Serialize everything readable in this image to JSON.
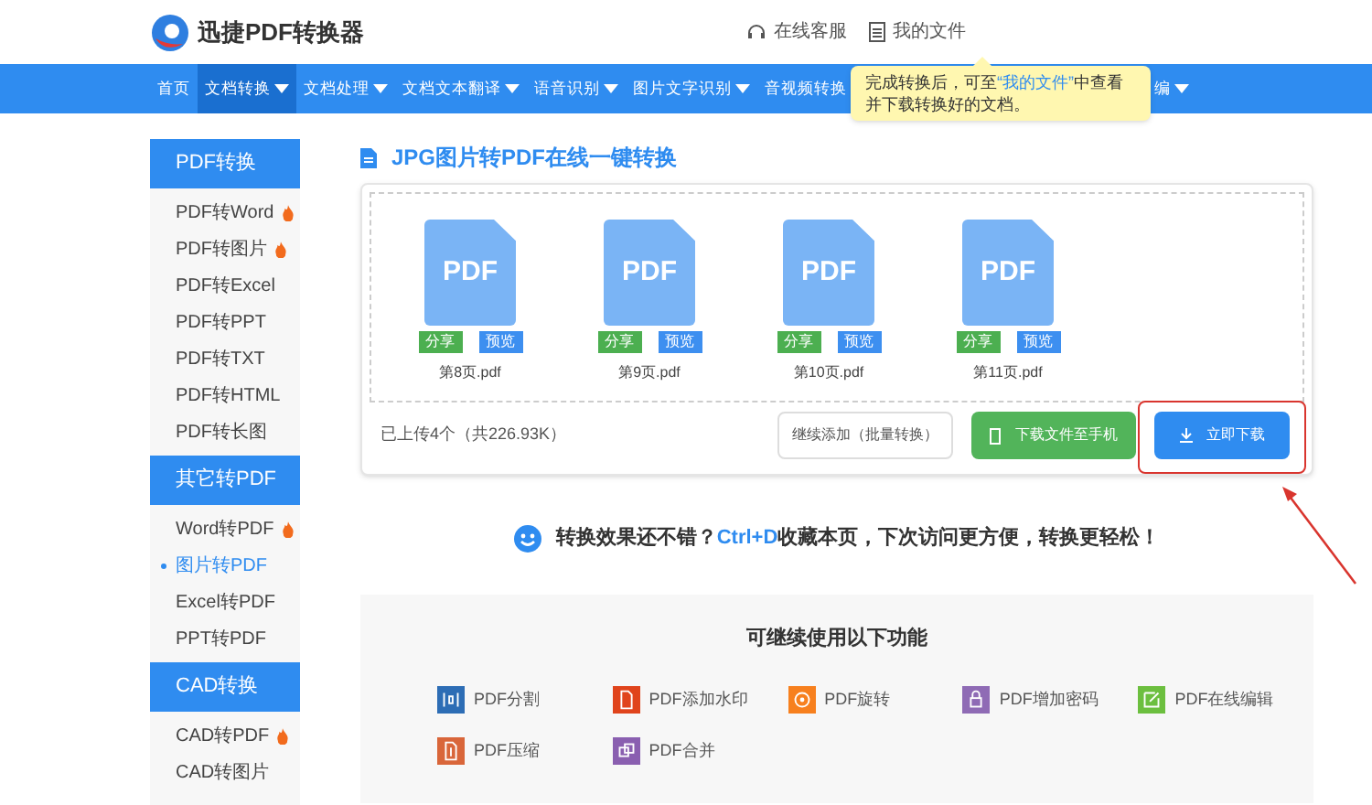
{
  "header": {
    "brand": "迅捷PDF转换器",
    "links": [
      "在线客服",
      "我的文件"
    ]
  },
  "nav": [
    {
      "label": "首页",
      "selected": false
    },
    {
      "label": "文档转换",
      "selected": true
    },
    {
      "label": "文档处理",
      "selected": false
    },
    {
      "label": "文档文本翻译",
      "selected": false
    },
    {
      "label": "语音识别",
      "selected": false
    },
    {
      "label": "图片文字识别",
      "selected": false
    },
    {
      "label": "音视频转换",
      "selected": false
    },
    {
      "label": "编",
      "selected": false
    }
  ],
  "tooltip": {
    "before": "完成转换后，可至",
    "link": "“我的文件”",
    "after": "中查看并下载转换好的文档。"
  },
  "sidebar": [
    {
      "title": "PDF转换",
      "items": [
        {
          "label": "PDF转Word",
          "hot": true,
          "selected": false
        },
        {
          "label": "PDF转图片",
          "hot": true,
          "selected": false
        },
        {
          "label": "PDF转Excel",
          "hot": false,
          "selected": false
        },
        {
          "label": "PDF转PPT",
          "hot": false,
          "selected": false
        },
        {
          "label": "PDF转TXT",
          "hot": false,
          "selected": false
        },
        {
          "label": "PDF转HTML",
          "hot": false,
          "selected": false
        },
        {
          "label": "PDF转长图",
          "hot": false,
          "selected": false
        }
      ]
    },
    {
      "title": "其它转PDF",
      "items": [
        {
          "label": "Word转PDF",
          "hot": true,
          "selected": false
        },
        {
          "label": "图片转PDF",
          "hot": false,
          "selected": true
        },
        {
          "label": "Excel转PDF",
          "hot": false,
          "selected": false
        },
        {
          "label": "PPT转PDF",
          "hot": false,
          "selected": false
        }
      ]
    },
    {
      "title": "CAD转换",
      "items": [
        {
          "label": "CAD转PDF",
          "hot": true,
          "selected": false
        },
        {
          "label": "CAD转图片",
          "hot": false,
          "selected": false
        }
      ]
    }
  ],
  "main": {
    "title": "JPG图片转PDF在线一键转换",
    "files": [
      {
        "icon_text": "PDF",
        "share": "分享",
        "preview": "预览",
        "name": "第8页.pdf"
      },
      {
        "icon_text": "PDF",
        "share": "分享",
        "preview": "预览",
        "name": "第9页.pdf"
      },
      {
        "icon_text": "PDF",
        "share": "分享",
        "preview": "预览",
        "name": "第10页.pdf"
      },
      {
        "icon_text": "PDF",
        "share": "分享",
        "preview": "预览",
        "name": "第11页.pdf"
      }
    ],
    "summary": "已上传4个（共226.93K）",
    "buttons": [
      {
        "kind": "outline",
        "label": "继续添加（批量转换）"
      },
      {
        "kind": "phone",
        "label": "下载文件至手机"
      },
      {
        "kind": "download",
        "label": "立即下载",
        "highlighted": true
      }
    ],
    "tip": "转换效果还不错？**Ctrl+D**收藏本页，下次访问更方便，转换更轻松！"
  },
  "features": {
    "title": "可继续使用以下功能",
    "items": [
      {
        "label": "PDF分割",
        "color": "#2d6db5"
      },
      {
        "label": "PDF添加水印",
        "color": "#e0441c"
      },
      {
        "label": "PDF旋转",
        "color": "#f7801e"
      },
      {
        "label": "PDF增加密码",
        "color": "#8f6bb5"
      },
      {
        "label": "PDF在线编辑",
        "color": "#6cbf3f"
      },
      {
        "label": "PDF压缩",
        "color": "#d9663a"
      },
      {
        "label": "PDF合并",
        "color": "#8a5fb0"
      }
    ]
  }
}
